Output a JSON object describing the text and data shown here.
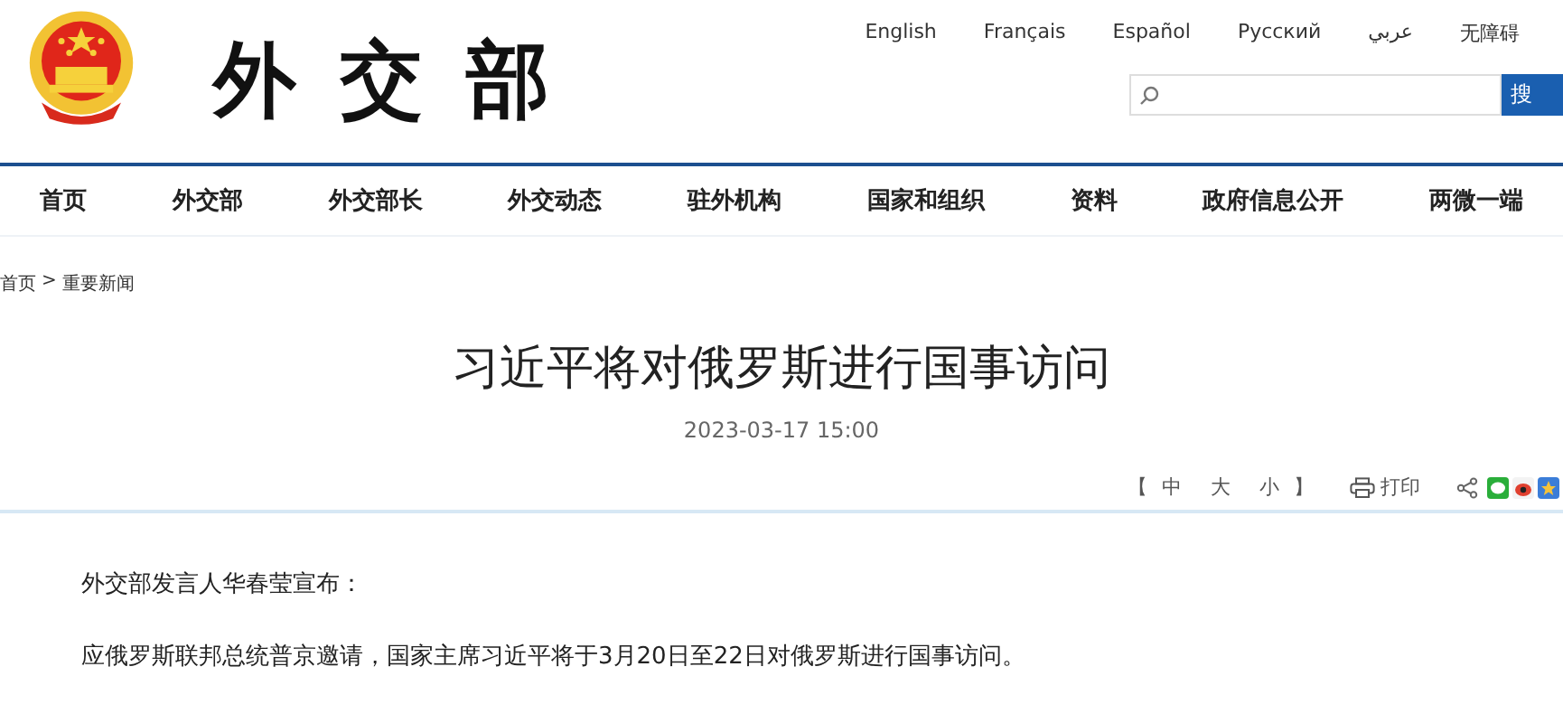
{
  "header": {
    "logo_text": "外交部",
    "languages": [
      "English",
      "Français",
      "Español",
      "Русский",
      "عربي",
      "无障碍"
    ],
    "search": {
      "button": "搜"
    }
  },
  "nav": [
    "首页",
    "外交部",
    "外交部长",
    "外交动态",
    "驻外机构",
    "国家和组织",
    "资料",
    "政府信息公开",
    "两微一端"
  ],
  "breadcrumb": {
    "items": [
      "首页",
      "重要新闻"
    ],
    "separator": ">"
  },
  "article": {
    "title": "习近平将对俄罗斯进行国事访问",
    "date": "2023-03-17 15:00",
    "tools": {
      "open": "【",
      "sizes": [
        "中",
        "大",
        "小"
      ],
      "close": "】",
      "print": "打印"
    },
    "paragraphs": [
      "外交部发言人华春莹宣布：",
      "应俄罗斯联邦总统普京邀请，国家主席习近平将于3月20日至22日对俄罗斯进行国事访问。"
    ]
  }
}
